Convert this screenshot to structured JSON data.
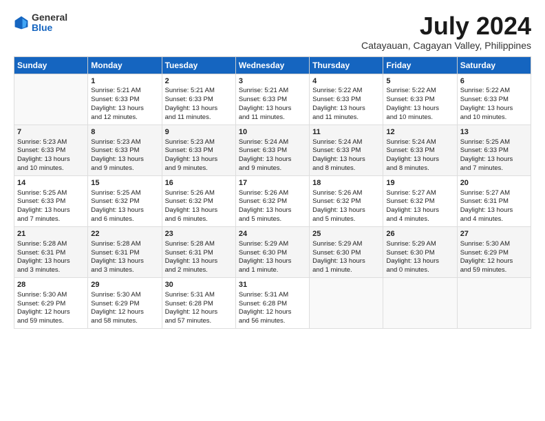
{
  "logo": {
    "general": "General",
    "blue": "Blue"
  },
  "title": "July 2024",
  "subtitle": "Catayauan, Cagayan Valley, Philippines",
  "headers": [
    "Sunday",
    "Monday",
    "Tuesday",
    "Wednesday",
    "Thursday",
    "Friday",
    "Saturday"
  ],
  "weeks": [
    [
      {
        "day": "",
        "content": ""
      },
      {
        "day": "1",
        "content": "Sunrise: 5:21 AM\nSunset: 6:33 PM\nDaylight: 13 hours\nand 12 minutes."
      },
      {
        "day": "2",
        "content": "Sunrise: 5:21 AM\nSunset: 6:33 PM\nDaylight: 13 hours\nand 11 minutes."
      },
      {
        "day": "3",
        "content": "Sunrise: 5:21 AM\nSunset: 6:33 PM\nDaylight: 13 hours\nand 11 minutes."
      },
      {
        "day": "4",
        "content": "Sunrise: 5:22 AM\nSunset: 6:33 PM\nDaylight: 13 hours\nand 11 minutes."
      },
      {
        "day": "5",
        "content": "Sunrise: 5:22 AM\nSunset: 6:33 PM\nDaylight: 13 hours\nand 10 minutes."
      },
      {
        "day": "6",
        "content": "Sunrise: 5:22 AM\nSunset: 6:33 PM\nDaylight: 13 hours\nand 10 minutes."
      }
    ],
    [
      {
        "day": "7",
        "content": "Sunrise: 5:23 AM\nSunset: 6:33 PM\nDaylight: 13 hours\nand 10 minutes."
      },
      {
        "day": "8",
        "content": "Sunrise: 5:23 AM\nSunset: 6:33 PM\nDaylight: 13 hours\nand 9 minutes."
      },
      {
        "day": "9",
        "content": "Sunrise: 5:23 AM\nSunset: 6:33 PM\nDaylight: 13 hours\nand 9 minutes."
      },
      {
        "day": "10",
        "content": "Sunrise: 5:24 AM\nSunset: 6:33 PM\nDaylight: 13 hours\nand 9 minutes."
      },
      {
        "day": "11",
        "content": "Sunrise: 5:24 AM\nSunset: 6:33 PM\nDaylight: 13 hours\nand 8 minutes."
      },
      {
        "day": "12",
        "content": "Sunrise: 5:24 AM\nSunset: 6:33 PM\nDaylight: 13 hours\nand 8 minutes."
      },
      {
        "day": "13",
        "content": "Sunrise: 5:25 AM\nSunset: 6:33 PM\nDaylight: 13 hours\nand 7 minutes."
      }
    ],
    [
      {
        "day": "14",
        "content": "Sunrise: 5:25 AM\nSunset: 6:33 PM\nDaylight: 13 hours\nand 7 minutes."
      },
      {
        "day": "15",
        "content": "Sunrise: 5:25 AM\nSunset: 6:32 PM\nDaylight: 13 hours\nand 6 minutes."
      },
      {
        "day": "16",
        "content": "Sunrise: 5:26 AM\nSunset: 6:32 PM\nDaylight: 13 hours\nand 6 minutes."
      },
      {
        "day": "17",
        "content": "Sunrise: 5:26 AM\nSunset: 6:32 PM\nDaylight: 13 hours\nand 5 minutes."
      },
      {
        "day": "18",
        "content": "Sunrise: 5:26 AM\nSunset: 6:32 PM\nDaylight: 13 hours\nand 5 minutes."
      },
      {
        "day": "19",
        "content": "Sunrise: 5:27 AM\nSunset: 6:32 PM\nDaylight: 13 hours\nand 4 minutes."
      },
      {
        "day": "20",
        "content": "Sunrise: 5:27 AM\nSunset: 6:31 PM\nDaylight: 13 hours\nand 4 minutes."
      }
    ],
    [
      {
        "day": "21",
        "content": "Sunrise: 5:28 AM\nSunset: 6:31 PM\nDaylight: 13 hours\nand 3 minutes."
      },
      {
        "day": "22",
        "content": "Sunrise: 5:28 AM\nSunset: 6:31 PM\nDaylight: 13 hours\nand 3 minutes."
      },
      {
        "day": "23",
        "content": "Sunrise: 5:28 AM\nSunset: 6:31 PM\nDaylight: 13 hours\nand 2 minutes."
      },
      {
        "day": "24",
        "content": "Sunrise: 5:29 AM\nSunset: 6:30 PM\nDaylight: 13 hours\nand 1 minute."
      },
      {
        "day": "25",
        "content": "Sunrise: 5:29 AM\nSunset: 6:30 PM\nDaylight: 13 hours\nand 1 minute."
      },
      {
        "day": "26",
        "content": "Sunrise: 5:29 AM\nSunset: 6:30 PM\nDaylight: 13 hours\nand 0 minutes."
      },
      {
        "day": "27",
        "content": "Sunrise: 5:30 AM\nSunset: 6:29 PM\nDaylight: 12 hours\nand 59 minutes."
      }
    ],
    [
      {
        "day": "28",
        "content": "Sunrise: 5:30 AM\nSunset: 6:29 PM\nDaylight: 12 hours\nand 59 minutes."
      },
      {
        "day": "29",
        "content": "Sunrise: 5:30 AM\nSunset: 6:29 PM\nDaylight: 12 hours\nand 58 minutes."
      },
      {
        "day": "30",
        "content": "Sunrise: 5:31 AM\nSunset: 6:28 PM\nDaylight: 12 hours\nand 57 minutes."
      },
      {
        "day": "31",
        "content": "Sunrise: 5:31 AM\nSunset: 6:28 PM\nDaylight: 12 hours\nand 56 minutes."
      },
      {
        "day": "",
        "content": ""
      },
      {
        "day": "",
        "content": ""
      },
      {
        "day": "",
        "content": ""
      }
    ]
  ]
}
